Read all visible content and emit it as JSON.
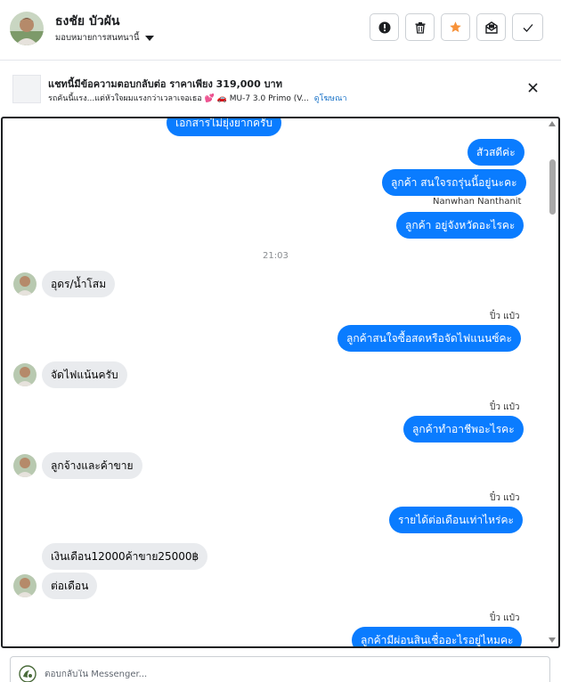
{
  "header": {
    "contact_name": "ธงชัย บัวผัน",
    "assign_label": "มอบหมายการสนทนานี้",
    "actions": {
      "spam": "exclamation-circle-icon",
      "delete": "trash-icon",
      "star": "star-icon",
      "unread": "envelope-icon",
      "done": "checkmark-icon"
    }
  },
  "ad": {
    "title": "แชทนี้มีข้อความตอบกลับต่อ ราคาเพียง 319,000 บาท",
    "subtitle": "รถคันนี้แรง...แต่หัวใจผมแรงกว่าเวลาเจอเธอ 💕 🚗 MU-7 3.0 Primo (V...",
    "link": "ดูโฆษณา"
  },
  "messages": {
    "m1": "เอกสารไม่ยุ่งยากครับ",
    "m2": "สัวสดีค่ะ",
    "m3": "ลูกค้า สนใจรถรุ่นนี้อยู่นะคะ",
    "sender1": "Nanwhan Nanthanit",
    "m4": "ลูกค้า อยู่จังหวัดอะไรคะ",
    "time": "21:03",
    "m5": "อุดร/น้ำโสม",
    "sender2": "ปิ๋ว แป๋ว",
    "m6": "ลูกค้าสนใจซื้อสดหรือจัดไฟแนนซ์คะ",
    "m7": "จัดไฟแน้นครับ",
    "sender3": "ปิ๋ว แป๋ว",
    "m8": "ลูกค้าทำอาชีพอะไรคะ",
    "m9": "ลูกจ้างและค้าขาย",
    "sender4": "ปิ๋ว แป๋ว",
    "m10": "รายได้ต่อเดือนเท่าไหร่คะ",
    "m11": "เงินเดือน12000ค้าขาย25000฿",
    "m12": "ต่อเดือน",
    "sender5": "ปิ๋ว แป๋ว",
    "m13": "ลูกค้ามีผ่อนสินเชื่ออะไรอยู่ไหมคะ"
  },
  "composer": {
    "placeholder": "ตอบกลับใน Messenger..."
  }
}
